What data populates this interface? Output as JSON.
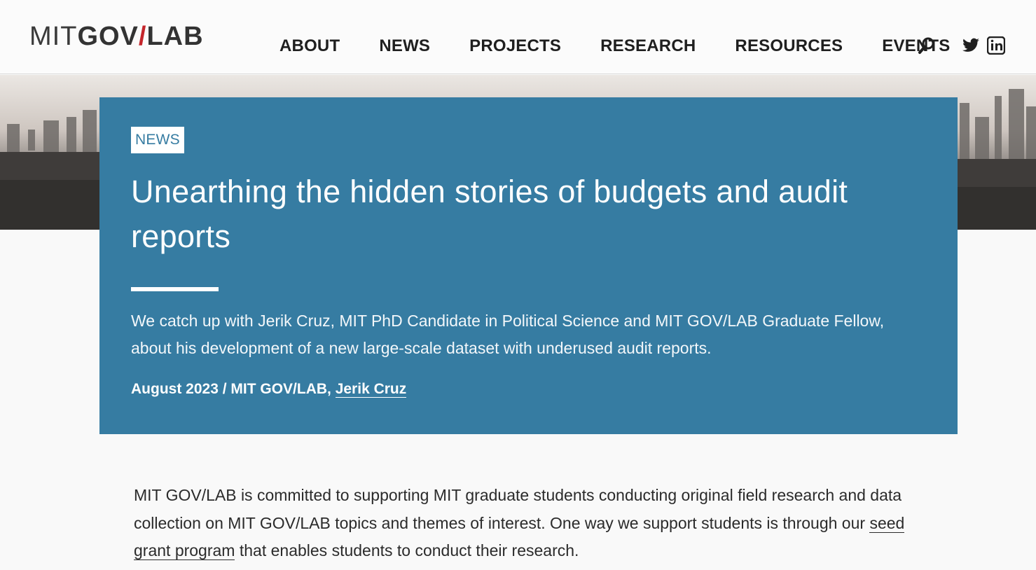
{
  "header": {
    "logo": {
      "part1": "MIT",
      "part2": "GOV",
      "slash": "/",
      "part3": "LAB"
    },
    "nav": [
      {
        "label": "ABOUT"
      },
      {
        "label": "NEWS"
      },
      {
        "label": "PROJECTS"
      },
      {
        "label": "RESEARCH"
      },
      {
        "label": "RESOURCES"
      },
      {
        "label": "EVENTS"
      }
    ],
    "icons": [
      "search-icon",
      "twitter-icon",
      "linkedin-icon"
    ]
  },
  "hero": {
    "tag": "NEWS",
    "title": "Unearthing the hidden stories of budgets and audit reports",
    "deck": "We catch up with Jerik Cruz, MIT PhD Candidate in Political Science and MIT GOV/LAB Graduate Fellow, about his development of a new large-scale dataset with underused audit reports.",
    "byline_prefix": "August 2023 / MIT GOV/LAB, ",
    "byline_author": "Jerik Cruz"
  },
  "body": {
    "para_before_link": "MIT GOV/LAB is committed to supporting MIT graduate students conducting original field research and data collection on MIT GOV/LAB topics and themes of interest. One way we support students is through our ",
    "link_text": "seed grant program",
    "para_after_link": " that enables students to conduct their research."
  },
  "colors": {
    "hero_card": "#367ca2",
    "logo_slash": "#c4252b",
    "page_bg": "#f9f9f9"
  }
}
